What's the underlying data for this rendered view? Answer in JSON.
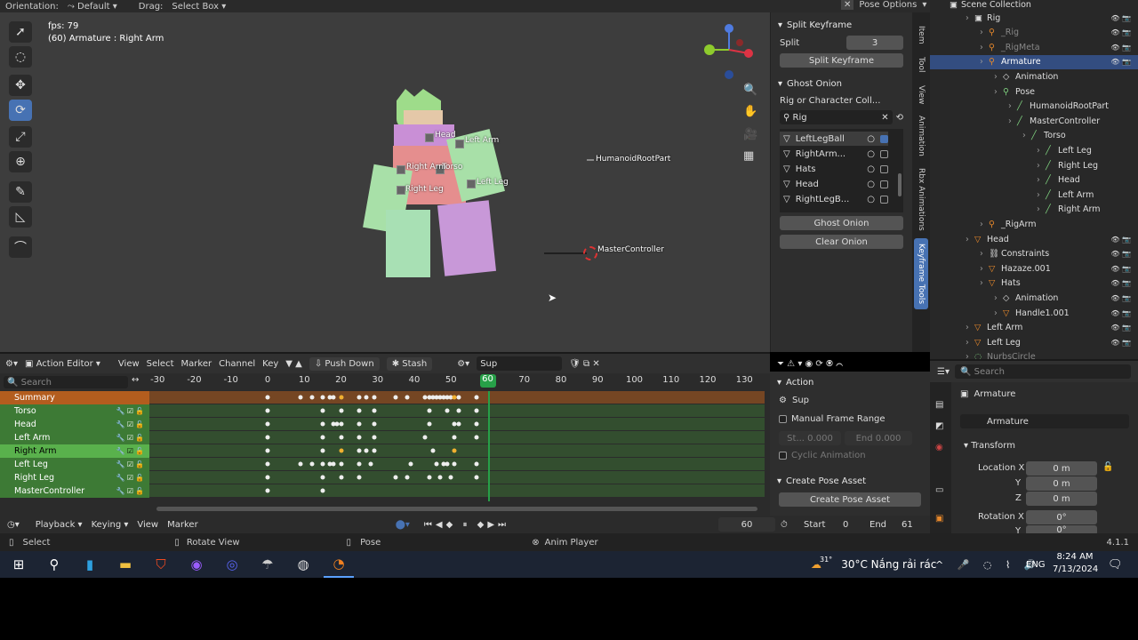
{
  "topbar": {
    "orientation_label": "Orientation:",
    "orientation_value": "Default",
    "drag_label": "Drag:",
    "drag_value": "Select Box",
    "pose_options": "Pose Options"
  },
  "viewport": {
    "fps": "fps: 79",
    "active": "(60) Armature : Right Arm",
    "labels": {
      "head": "Head",
      "left_arm": "Left Arm",
      "right_arm": "Right Arm",
      "torso": "Torso",
      "left_leg": "Left Leg",
      "right_leg": "Right Leg",
      "hrp": "HumanoidRootPart",
      "master": "MasterController"
    }
  },
  "npanel": {
    "split_title": "Split Keyframe",
    "split_label": "Split",
    "split_value": "3",
    "split_button": "Split Keyframe",
    "ghost_title": "Ghost Onion",
    "rig_collection_label": "Rig or Character Coll...",
    "rig_value": "Rig",
    "list": [
      {
        "name": "LeftLegBall",
        "checked": true,
        "selected": true
      },
      {
        "name": "RightArm...",
        "checked": false,
        "selected": false
      },
      {
        "name": "Hats",
        "checked": false,
        "selected": false
      },
      {
        "name": "Head",
        "checked": false,
        "selected": false
      },
      {
        "name": "RightLegB...",
        "checked": false,
        "selected": false
      }
    ],
    "ghost_button": "Ghost Onion",
    "clear_button": "Clear Onion"
  },
  "vtabs": [
    "Item",
    "Tool",
    "View",
    "Animation",
    "Rbx Animations",
    "Keyframe Tools"
  ],
  "outliner": {
    "title": "Scene Collection",
    "rows": [
      {
        "label": "Rig",
        "indent": 1,
        "icon": "collection-icon",
        "color": "#ddd"
      },
      {
        "label": "_Rig",
        "indent": 2,
        "icon": "armature-icon",
        "color": "#888"
      },
      {
        "label": "_RigMeta",
        "indent": 2,
        "icon": "armature-icon",
        "color": "#888"
      },
      {
        "label": "Armature",
        "indent": 2,
        "icon": "armature-icon",
        "color": "#fff",
        "selected": true
      },
      {
        "label": "Animation",
        "indent": 3,
        "icon": "animation-icon",
        "color": "#ddd"
      },
      {
        "label": "Pose",
        "indent": 3,
        "icon": "pose-icon",
        "color": "#ddd"
      },
      {
        "label": "HumanoidRootPart",
        "indent": 4,
        "icon": "bone-icon",
        "color": "#ddd"
      },
      {
        "label": "MasterController",
        "indent": 4,
        "icon": "bone-icon",
        "color": "#ddd"
      },
      {
        "label": "Torso",
        "indent": 5,
        "icon": "bone-icon",
        "color": "#ddd"
      },
      {
        "label": "Left Leg",
        "indent": 6,
        "icon": "bone-icon",
        "color": "#ddd"
      },
      {
        "label": "Right Leg",
        "indent": 6,
        "icon": "bone-icon",
        "color": "#ddd"
      },
      {
        "label": "Head",
        "indent": 6,
        "icon": "bone-icon",
        "color": "#ddd"
      },
      {
        "label": "Left Arm",
        "indent": 6,
        "icon": "bone-icon",
        "color": "#ddd"
      },
      {
        "label": "Right Arm",
        "indent": 6,
        "icon": "bone-icon",
        "color": "#ddd"
      },
      {
        "label": "_RigArm",
        "indent": 2,
        "icon": "armature-icon",
        "color": "#ddd"
      },
      {
        "label": "Head",
        "indent": 1,
        "icon": "mesh-icon",
        "color": "#ddd"
      },
      {
        "label": "Constraints",
        "indent": 2,
        "icon": "constraint-icon",
        "color": "#ddd"
      },
      {
        "label": "Hazaze.001",
        "indent": 2,
        "icon": "mesh-icon",
        "color": "#ddd"
      },
      {
        "label": "Hats",
        "indent": 2,
        "icon": "mesh-icon",
        "color": "#ddd"
      },
      {
        "label": "Animation",
        "indent": 3,
        "icon": "animation-icon",
        "color": "#ddd"
      },
      {
        "label": "Handle1.001",
        "indent": 3,
        "icon": "mesh-icon",
        "color": "#ddd"
      },
      {
        "label": "Left Arm",
        "indent": 1,
        "icon": "mesh-icon",
        "color": "#ddd"
      },
      {
        "label": "Left Leg",
        "indent": 1,
        "icon": "mesh-icon",
        "color": "#ddd"
      },
      {
        "label": "NurbsCircle",
        "indent": 1,
        "icon": "curve-icon",
        "color": "#888"
      }
    ]
  },
  "props": {
    "search_placeholder": "Search",
    "object_name": "Armature",
    "object_field": "Armature",
    "transform_title": "Transform",
    "location_label": "Location X",
    "y_label": "Y",
    "z_label": "Z",
    "loc_x": "0 m",
    "loc_y": "0 m",
    "loc_z": "0 m",
    "rotation_label": "Rotation X",
    "rot_x": "0°",
    "rot_y": "0°"
  },
  "dope": {
    "editor": "Action Editor",
    "menus": [
      "View",
      "Select",
      "Marker",
      "Channel",
      "Key"
    ],
    "push_down": "Push Down",
    "stash": "Stash",
    "action_name": "Sup",
    "search_placeholder": "Search",
    "ticks": [
      -30,
      -20,
      -10,
      0,
      10,
      20,
      30,
      40,
      50,
      60,
      70,
      80,
      90,
      100,
      110,
      120,
      130
    ],
    "current_frame": 60,
    "channels": [
      {
        "name": "Summary",
        "keys": [
          0,
          9,
          12,
          15,
          17,
          18,
          20,
          25,
          27,
          29,
          35,
          38,
          43,
          44,
          45,
          46,
          47,
          48,
          49,
          50,
          51,
          52,
          57
        ],
        "yellow": [
          20,
          51
        ]
      },
      {
        "name": "Torso",
        "keys": [
          0,
          15,
          20,
          25,
          29,
          44,
          49,
          52,
          57
        ],
        "yellow": []
      },
      {
        "name": "Head",
        "keys": [
          0,
          15,
          18,
          19,
          20,
          25,
          29,
          44,
          51,
          52,
          57
        ],
        "yellow": []
      },
      {
        "name": "Left Arm",
        "keys": [
          0,
          15,
          20,
          25,
          29,
          43,
          51,
          57
        ],
        "yellow": []
      },
      {
        "name": "Right Arm",
        "keys": [
          0,
          15,
          20,
          25,
          27,
          29,
          45,
          51
        ],
        "yellow": [
          20,
          51
        ]
      },
      {
        "name": "Left Leg",
        "keys": [
          0,
          9,
          12,
          15,
          17,
          18,
          20,
          25,
          28,
          39,
          46,
          48,
          49,
          51,
          57
        ],
        "yellow": []
      },
      {
        "name": "Right Leg",
        "keys": [
          0,
          15,
          20,
          25,
          35,
          38,
          44,
          47,
          50,
          57
        ],
        "yellow": []
      },
      {
        "name": "MasterController",
        "keys": [
          0,
          15
        ],
        "yellow": []
      }
    ]
  },
  "side": {
    "action_title": "Action",
    "action_name": "Sup",
    "manual_frame_range": "Manual Frame Range",
    "start_label": "St...",
    "start_value": "0.000",
    "end_label": "End",
    "end_value": "0.000",
    "cyclic": "Cyclic Animation",
    "pose_asset_title": "Create Pose Asset",
    "pose_asset_button": "Create Pose Asset"
  },
  "timeline": {
    "playback": "Playback",
    "keying": "Keying",
    "view": "View",
    "marker": "Marker",
    "frame": "60",
    "start_label": "Start",
    "start": "0",
    "end_label": "End",
    "end": "61"
  },
  "status": {
    "select": "Select",
    "rotate": "Rotate View",
    "pose": "Pose",
    "anim_player": "Anim Player",
    "version": "4.1.1"
  },
  "taskbar": {
    "weather": "30°C  Nắng rải rác",
    "temp_badge": "31°",
    "lang": "ENG",
    "time": "8:24 AM",
    "date": "7/13/2024"
  },
  "colors": {
    "accent": "#4772b3",
    "summary": "#b35d1e",
    "channel_green": "#3d7a35",
    "channel_green_active": "#59b14c",
    "playhead": "#27a048"
  }
}
